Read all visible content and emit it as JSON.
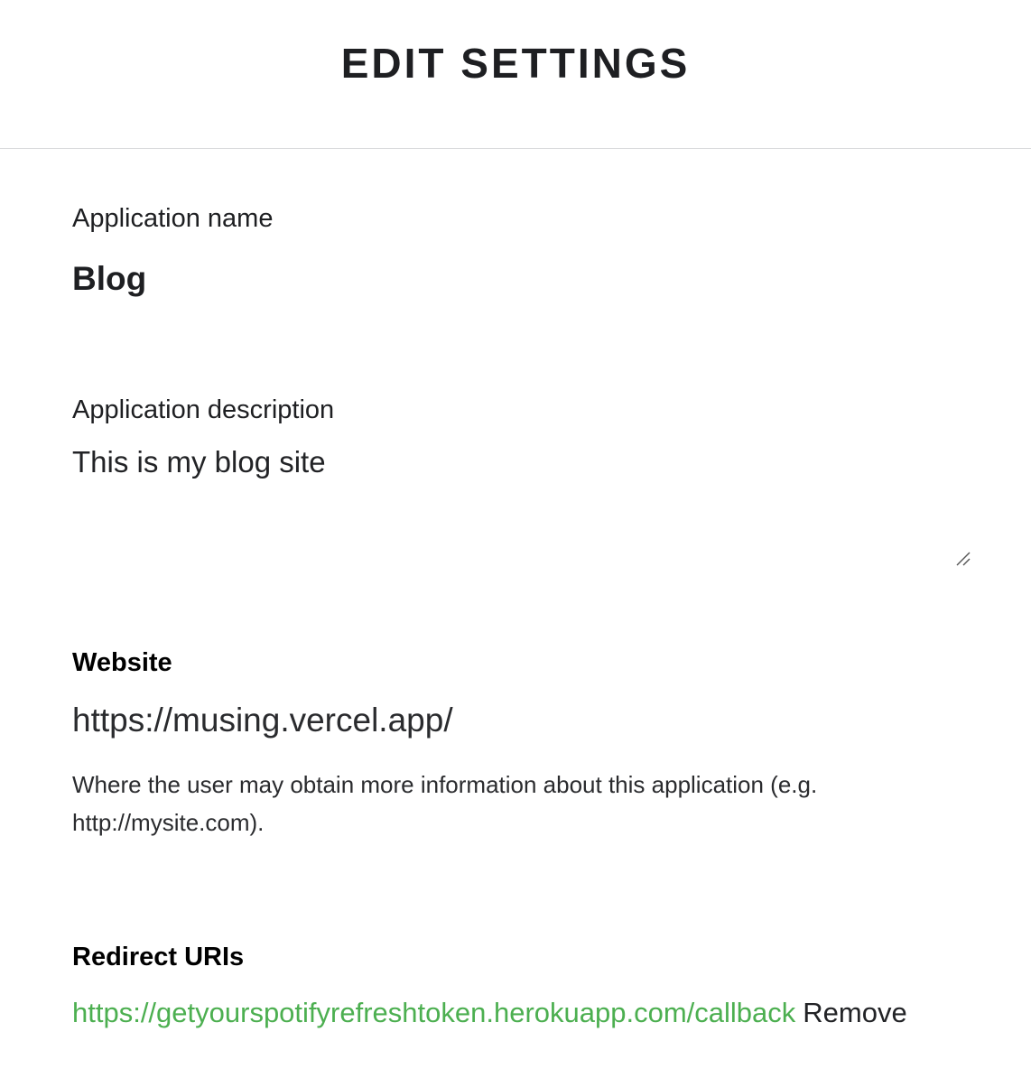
{
  "header": {
    "title": "EDIT SETTINGS"
  },
  "app_name": {
    "label": "Application name",
    "value": "Blog"
  },
  "app_description": {
    "label": "Application description",
    "value": "This is my blog site"
  },
  "website": {
    "label": "Website",
    "value": "https://musing.vercel.app/",
    "help": "Where the user may obtain more information about this application (e.g. http://mysite.com)."
  },
  "redirect_uris": {
    "label": "Redirect URIs",
    "items": [
      {
        "uri": "https://getyourspotifyrefreshtoken.herokuapp.com/callback",
        "remove_label": "Remove"
      }
    ]
  },
  "colors": {
    "link_green": "#4caf50",
    "divider": "#d9dadc",
    "text": "#222326"
  }
}
